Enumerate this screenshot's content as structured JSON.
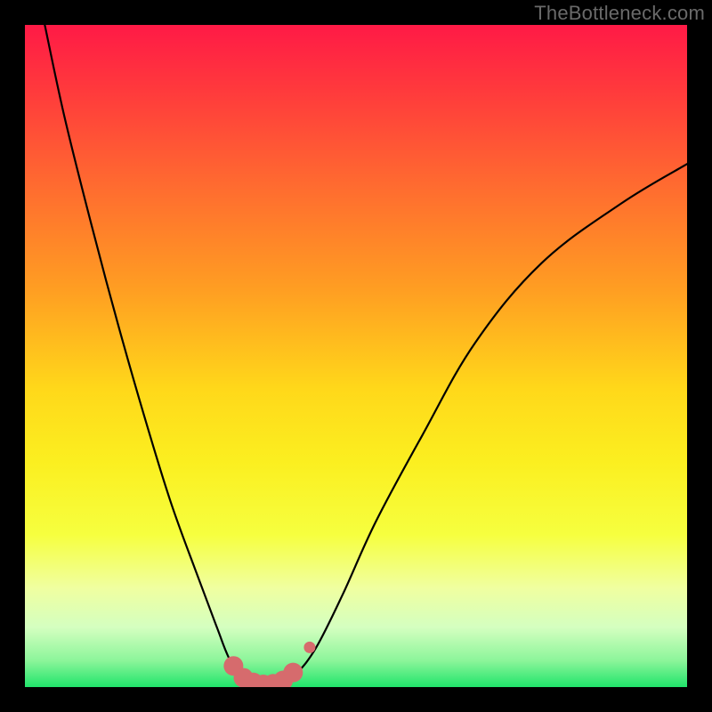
{
  "watermark": "TheBottleneck.com",
  "colors": {
    "frame": "#000000",
    "curve": "#000000",
    "marker_fill": "#d66b6d",
    "marker_stroke": "#c85a5c"
  },
  "chart_data": {
    "type": "line",
    "title": "",
    "xlabel": "",
    "ylabel": "",
    "xlim": [
      0,
      100
    ],
    "ylim": [
      0,
      100
    ],
    "note": "Unlabeled bottleneck/error curve. X and Y axes have no tick labels; values below are positional estimates (percent of plot area, origin bottom-left). Markers highlight the optimal (minimum) region around x≈33–41.",
    "series": [
      {
        "name": "left-branch",
        "x": [
          3,
          6,
          10,
          14,
          18,
          22,
          26,
          29,
          31,
          33,
          35
        ],
        "y": [
          100,
          86,
          70,
          55,
          41,
          28,
          17,
          9,
          4,
          1.5,
          0.5
        ]
      },
      {
        "name": "right-branch",
        "x": [
          39,
          41,
          44,
          48,
          53,
          60,
          68,
          78,
          90,
          100
        ],
        "y": [
          0.5,
          2,
          6,
          14,
          25,
          38,
          52,
          64,
          73,
          79
        ]
      }
    ],
    "markers": {
      "name": "optimal-region",
      "x": [
        31.5,
        33,
        34.5,
        36,
        37.5,
        39,
        40.5,
        43
      ],
      "y": [
        3.2,
        1.4,
        0.7,
        0.4,
        0.5,
        1.0,
        2.2,
        6.0
      ],
      "size_large_indices": [
        0,
        1,
        2,
        3,
        4,
        5,
        6
      ],
      "size_small_indices": [
        7
      ]
    }
  }
}
